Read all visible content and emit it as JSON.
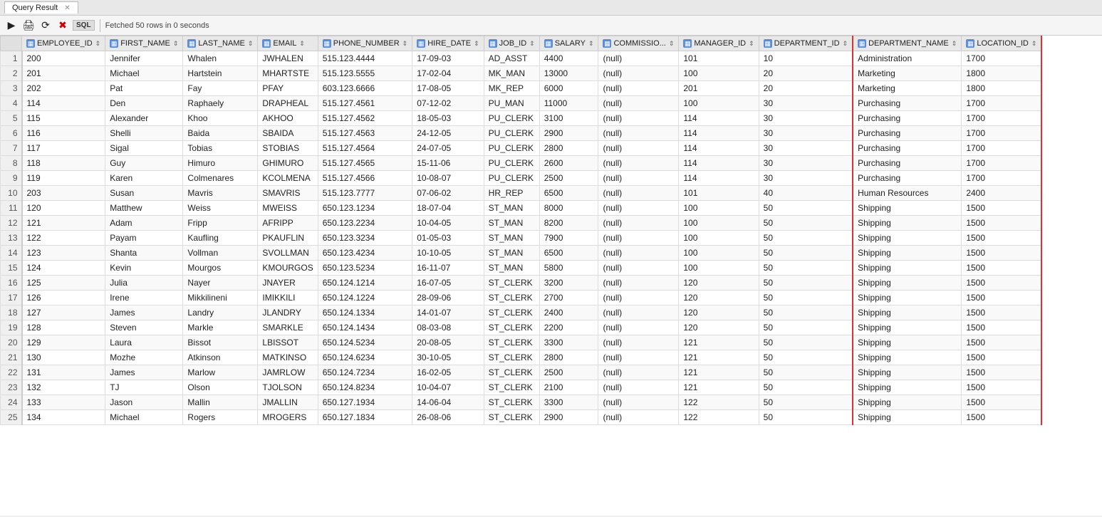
{
  "appHeader": {
    "tabs": [
      {
        "label": "Query Result",
        "active": true,
        "closeable": true
      }
    ]
  },
  "toolbar": {
    "fetchedText": "Fetched 50 rows in 0 seconds",
    "sqlLabel": "SQL"
  },
  "columns": [
    {
      "id": "row_num",
      "label": ""
    },
    {
      "id": "employee_id",
      "label": "EMPLOYEE_ID"
    },
    {
      "id": "first_name",
      "label": "FIRST_NAME"
    },
    {
      "id": "last_name",
      "label": "LAST_NAME"
    },
    {
      "id": "email",
      "label": "EMAIL"
    },
    {
      "id": "phone_number",
      "label": "PHONE_NUMBER"
    },
    {
      "id": "hire_date",
      "label": "HIRE_DATE"
    },
    {
      "id": "job_id",
      "label": "JOB_ID"
    },
    {
      "id": "salary",
      "label": "SALARY"
    },
    {
      "id": "commission",
      "label": "COMMISSIO..."
    },
    {
      "id": "manager_id",
      "label": "MANAGER_ID"
    },
    {
      "id": "department_id",
      "label": "DEPARTMENT_ID"
    },
    {
      "id": "department_name",
      "label": "DEPARTMENT_NAME"
    },
    {
      "id": "location_id",
      "label": "LOCATION_ID"
    }
  ],
  "rows": [
    {
      "row": 1,
      "employee_id": 200,
      "first_name": "Jennifer",
      "last_name": "Whalen",
      "email": "JWHALEN",
      "phone_number": "515.123.4444",
      "hire_date": "17-09-03",
      "job_id": "AD_ASST",
      "salary": 4400,
      "commission": "(null)",
      "manager_id": 101,
      "department_id": 10,
      "department_name": "Administration",
      "location_id": 1700
    },
    {
      "row": 2,
      "employee_id": 201,
      "first_name": "Michael",
      "last_name": "Hartstein",
      "email": "MHARTSTE",
      "phone_number": "515.123.5555",
      "hire_date": "17-02-04",
      "job_id": "MK_MAN",
      "salary": 13000,
      "commission": "(null)",
      "manager_id": 100,
      "department_id": 20,
      "department_name": "Marketing",
      "location_id": 1800
    },
    {
      "row": 3,
      "employee_id": 202,
      "first_name": "Pat",
      "last_name": "Fay",
      "email": "PFAY",
      "phone_number": "603.123.6666",
      "hire_date": "17-08-05",
      "job_id": "MK_REP",
      "salary": 6000,
      "commission": "(null)",
      "manager_id": 201,
      "department_id": 20,
      "department_name": "Marketing",
      "location_id": 1800
    },
    {
      "row": 4,
      "employee_id": 114,
      "first_name": "Den",
      "last_name": "Raphaely",
      "email": "DRAPHEAL",
      "phone_number": "515.127.4561",
      "hire_date": "07-12-02",
      "job_id": "PU_MAN",
      "salary": 11000,
      "commission": "(null)",
      "manager_id": 100,
      "department_id": 30,
      "department_name": "Purchasing",
      "location_id": 1700
    },
    {
      "row": 5,
      "employee_id": 115,
      "first_name": "Alexander",
      "last_name": "Khoo",
      "email": "AKHOO",
      "phone_number": "515.127.4562",
      "hire_date": "18-05-03",
      "job_id": "PU_CLERK",
      "salary": 3100,
      "commission": "(null)",
      "manager_id": 114,
      "department_id": 30,
      "department_name": "Purchasing",
      "location_id": 1700
    },
    {
      "row": 6,
      "employee_id": 116,
      "first_name": "Shelli",
      "last_name": "Baida",
      "email": "SBAIDA",
      "phone_number": "515.127.4563",
      "hire_date": "24-12-05",
      "job_id": "PU_CLERK",
      "salary": 2900,
      "commission": "(null)",
      "manager_id": 114,
      "department_id": 30,
      "department_name": "Purchasing",
      "location_id": 1700
    },
    {
      "row": 7,
      "employee_id": 117,
      "first_name": "Sigal",
      "last_name": "Tobias",
      "email": "STOBIAS",
      "phone_number": "515.127.4564",
      "hire_date": "24-07-05",
      "job_id": "PU_CLERK",
      "salary": 2800,
      "commission": "(null)",
      "manager_id": 114,
      "department_id": 30,
      "department_name": "Purchasing",
      "location_id": 1700
    },
    {
      "row": 8,
      "employee_id": 118,
      "first_name": "Guy",
      "last_name": "Himuro",
      "email": "GHIMURO",
      "phone_number": "515.127.4565",
      "hire_date": "15-11-06",
      "job_id": "PU_CLERK",
      "salary": 2600,
      "commission": "(null)",
      "manager_id": 114,
      "department_id": 30,
      "department_name": "Purchasing",
      "location_id": 1700
    },
    {
      "row": 9,
      "employee_id": 119,
      "first_name": "Karen",
      "last_name": "Colmenares",
      "email": "KCOLMENA",
      "phone_number": "515.127.4566",
      "hire_date": "10-08-07",
      "job_id": "PU_CLERK",
      "salary": 2500,
      "commission": "(null)",
      "manager_id": 114,
      "department_id": 30,
      "department_name": "Purchasing",
      "location_id": 1700
    },
    {
      "row": 10,
      "employee_id": 203,
      "first_name": "Susan",
      "last_name": "Mavris",
      "email": "SMAVRIS",
      "phone_number": "515.123.7777",
      "hire_date": "07-06-02",
      "job_id": "HR_REP",
      "salary": 6500,
      "commission": "(null)",
      "manager_id": 101,
      "department_id": 40,
      "department_name": "Human Resources",
      "location_id": 2400
    },
    {
      "row": 11,
      "employee_id": 120,
      "first_name": "Matthew",
      "last_name": "Weiss",
      "email": "MWEISS",
      "phone_number": "650.123.1234",
      "hire_date": "18-07-04",
      "job_id": "ST_MAN",
      "salary": 8000,
      "commission": "(null)",
      "manager_id": 100,
      "department_id": 50,
      "department_name": "Shipping",
      "location_id": 1500
    },
    {
      "row": 12,
      "employee_id": 121,
      "first_name": "Adam",
      "last_name": "Fripp",
      "email": "AFRIPP",
      "phone_number": "650.123.2234",
      "hire_date": "10-04-05",
      "job_id": "ST_MAN",
      "salary": 8200,
      "commission": "(null)",
      "manager_id": 100,
      "department_id": 50,
      "department_name": "Shipping",
      "location_id": 1500
    },
    {
      "row": 13,
      "employee_id": 122,
      "first_name": "Payam",
      "last_name": "Kaufling",
      "email": "PKAUFLIN",
      "phone_number": "650.123.3234",
      "hire_date": "01-05-03",
      "job_id": "ST_MAN",
      "salary": 7900,
      "commission": "(null)",
      "manager_id": 100,
      "department_id": 50,
      "department_name": "Shipping",
      "location_id": 1500
    },
    {
      "row": 14,
      "employee_id": 123,
      "first_name": "Shanta",
      "last_name": "Vollman",
      "email": "SVOLLMAN",
      "phone_number": "650.123.4234",
      "hire_date": "10-10-05",
      "job_id": "ST_MAN",
      "salary": 6500,
      "commission": "(null)",
      "manager_id": 100,
      "department_id": 50,
      "department_name": "Shipping",
      "location_id": 1500
    },
    {
      "row": 15,
      "employee_id": 124,
      "first_name": "Kevin",
      "last_name": "Mourgos",
      "email": "KMOURGOS",
      "phone_number": "650.123.5234",
      "hire_date": "16-11-07",
      "job_id": "ST_MAN",
      "salary": 5800,
      "commission": "(null)",
      "manager_id": 100,
      "department_id": 50,
      "department_name": "Shipping",
      "location_id": 1500
    },
    {
      "row": 16,
      "employee_id": 125,
      "first_name": "Julia",
      "last_name": "Nayer",
      "email": "JNAYER",
      "phone_number": "650.124.1214",
      "hire_date": "16-07-05",
      "job_id": "ST_CLERK",
      "salary": 3200,
      "commission": "(null)",
      "manager_id": 120,
      "department_id": 50,
      "department_name": "Shipping",
      "location_id": 1500
    },
    {
      "row": 17,
      "employee_id": 126,
      "first_name": "Irene",
      "last_name": "Mikkilineni",
      "email": "IMIKKILI",
      "phone_number": "650.124.1224",
      "hire_date": "28-09-06",
      "job_id": "ST_CLERK",
      "salary": 2700,
      "commission": "(null)",
      "manager_id": 120,
      "department_id": 50,
      "department_name": "Shipping",
      "location_id": 1500
    },
    {
      "row": 18,
      "employee_id": 127,
      "first_name": "James",
      "last_name": "Landry",
      "email": "JLANDRY",
      "phone_number": "650.124.1334",
      "hire_date": "14-01-07",
      "job_id": "ST_CLERK",
      "salary": 2400,
      "commission": "(null)",
      "manager_id": 120,
      "department_id": 50,
      "department_name": "Shipping",
      "location_id": 1500
    },
    {
      "row": 19,
      "employee_id": 128,
      "first_name": "Steven",
      "last_name": "Markle",
      "email": "SMARKLE",
      "phone_number": "650.124.1434",
      "hire_date": "08-03-08",
      "job_id": "ST_CLERK",
      "salary": 2200,
      "commission": "(null)",
      "manager_id": 120,
      "department_id": 50,
      "department_name": "Shipping",
      "location_id": 1500
    },
    {
      "row": 20,
      "employee_id": 129,
      "first_name": "Laura",
      "last_name": "Bissot",
      "email": "LBISSOT",
      "phone_number": "650.124.5234",
      "hire_date": "20-08-05",
      "job_id": "ST_CLERK",
      "salary": 3300,
      "commission": "(null)",
      "manager_id": 121,
      "department_id": 50,
      "department_name": "Shipping",
      "location_id": 1500
    },
    {
      "row": 21,
      "employee_id": 130,
      "first_name": "Mozhe",
      "last_name": "Atkinson",
      "email": "MATKINSO",
      "phone_number": "650.124.6234",
      "hire_date": "30-10-05",
      "job_id": "ST_CLERK",
      "salary": 2800,
      "commission": "(null)",
      "manager_id": 121,
      "department_id": 50,
      "department_name": "Shipping",
      "location_id": 1500
    },
    {
      "row": 22,
      "employee_id": 131,
      "first_name": "James",
      "last_name": "Marlow",
      "email": "JAMRLOW",
      "phone_number": "650.124.7234",
      "hire_date": "16-02-05",
      "job_id": "ST_CLERK",
      "salary": 2500,
      "commission": "(null)",
      "manager_id": 121,
      "department_id": 50,
      "department_name": "Shipping",
      "location_id": 1500
    },
    {
      "row": 23,
      "employee_id": 132,
      "first_name": "TJ",
      "last_name": "Olson",
      "email": "TJOLSON",
      "phone_number": "650.124.8234",
      "hire_date": "10-04-07",
      "job_id": "ST_CLERK",
      "salary": 2100,
      "commission": "(null)",
      "manager_id": 121,
      "department_id": 50,
      "department_name": "Shipping",
      "location_id": 1500
    },
    {
      "row": 24,
      "employee_id": 133,
      "first_name": "Jason",
      "last_name": "Mallin",
      "email": "JMALLIN",
      "phone_number": "650.127.1934",
      "hire_date": "14-06-04",
      "job_id": "ST_CLERK",
      "salary": 3300,
      "commission": "(null)",
      "manager_id": 122,
      "department_id": 50,
      "department_name": "Shipping",
      "location_id": 1500
    },
    {
      "row": 25,
      "employee_id": 134,
      "first_name": "Michael",
      "last_name": "Rogers",
      "email": "MROGERS",
      "phone_number": "650.127.1834",
      "hire_date": "26-08-06",
      "job_id": "ST_CLERK",
      "salary": 2900,
      "commission": "(null)",
      "manager_id": 122,
      "department_id": 50,
      "department_name": "Shipping",
      "location_id": 1500
    }
  ]
}
